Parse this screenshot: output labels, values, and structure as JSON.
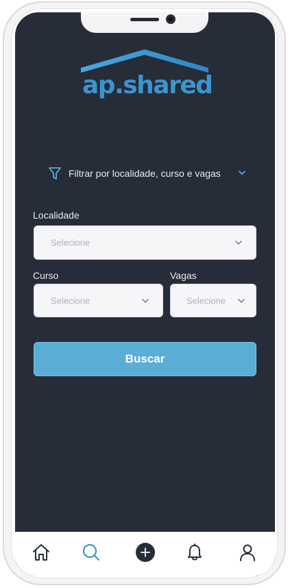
{
  "app": {
    "logo_text": "ap.shared",
    "brand_colors": {
      "primary": "#3a95cf",
      "screen_bg": "#262c38",
      "button": "#5aaed6"
    }
  },
  "filter": {
    "label": "Filtrar por localidade, curso e vagas",
    "icon": "funnel-icon",
    "expand_icon": "chevron-down-icon"
  },
  "form": {
    "localidade": {
      "label": "Localidade",
      "placeholder": "Selecione"
    },
    "curso": {
      "label": "Curso",
      "placeholder": "Selecione"
    },
    "vagas": {
      "label": "Vagas",
      "placeholder": "Selecione"
    },
    "submit_label": "Buscar"
  },
  "tabbar": {
    "items": [
      {
        "name": "home",
        "icon": "home-icon",
        "active": false
      },
      {
        "name": "search",
        "icon": "search-icon",
        "active": true
      },
      {
        "name": "add",
        "icon": "plus-circle-icon",
        "active": false
      },
      {
        "name": "notifications",
        "icon": "bell-icon",
        "active": false
      },
      {
        "name": "profile",
        "icon": "user-icon",
        "active": false
      }
    ],
    "active_color": "#3a95cf",
    "inactive_color": "#262c38"
  }
}
